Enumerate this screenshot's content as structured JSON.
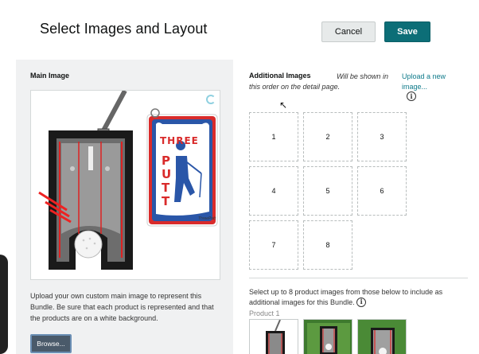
{
  "header": {
    "title": "Select Images and Layout",
    "cancel_label": "Cancel",
    "save_label": "Save"
  },
  "main_image": {
    "label": "Main Image",
    "towel_text": [
      "THREE",
      "PUTT"
    ],
    "description": "Upload your own custom main image to represent this Bundle. Be sure that each product is represented and that the products are on a white background.",
    "browse_label": "Browse..."
  },
  "additional": {
    "title": "Additional Images",
    "note": "Will be shown in this order on the detail page.",
    "upload_link": "Upload a new image...",
    "slots": [
      "1",
      "2",
      "3",
      "4",
      "5",
      "6",
      "7",
      "8"
    ]
  },
  "selection": {
    "description": "Select up to 8 product images from those below to include as additional images for this Bundle.",
    "product_label": "Product 1"
  },
  "colors": {
    "accent": "#0c6e77",
    "link": "#0e7a8a",
    "towel_blue": "#2a56a8",
    "towel_red": "#d92b2b"
  }
}
